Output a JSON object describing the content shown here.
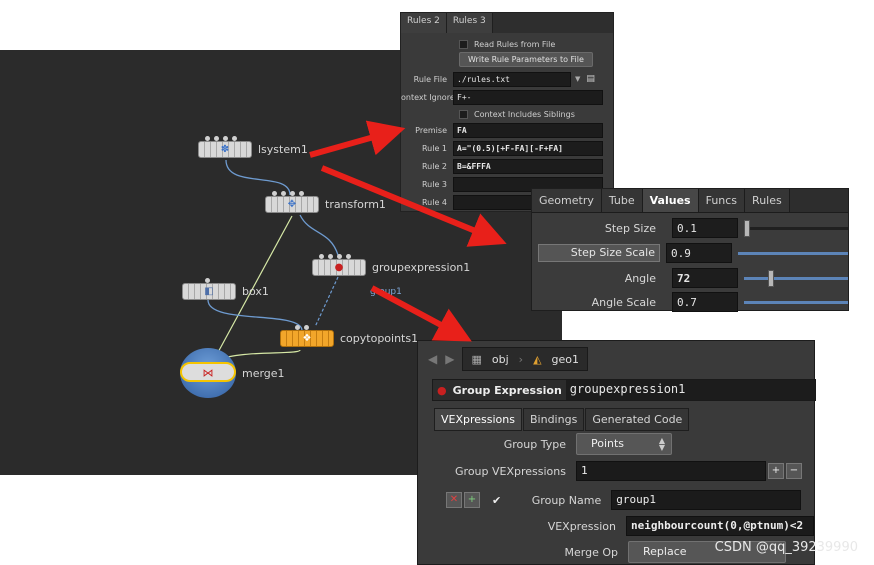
{
  "network": {
    "nodes": [
      {
        "name": "lsystem1",
        "icon": "lsystem-icon"
      },
      {
        "name": "transform1",
        "icon": "transform-icon"
      },
      {
        "name": "groupexpression1",
        "icon": "group-expression-icon",
        "sublabel": "group1"
      },
      {
        "name": "box1",
        "icon": "box-icon"
      },
      {
        "name": "copytopoints1",
        "icon": "copy-icon"
      },
      {
        "name": "merge1",
        "icon": "merge-icon"
      }
    ]
  },
  "rules_panel": {
    "tabs": [
      "Rules 2",
      "Rules 3"
    ],
    "read_rules_from_file": "Read Rules from File",
    "write_rule_button": "Write Rule Parameters to File",
    "rule_file_label": "Rule File",
    "rule_file_value": "./rules.txt",
    "context_ignore_label": "ontext Ignore",
    "context_ignore_value": "F+-",
    "context_siblings": "Context Includes Siblings",
    "premise_label": "Premise",
    "premise_value": "FA",
    "rule1_label": "Rule 1",
    "rule1_value": "A=\"(0.5)[+F-FA][-F+FA]",
    "rule2_label": "Rule 2",
    "rule2_value": "B=&FFFA",
    "rule3_label": "Rule 3",
    "rule3_value": "",
    "rule4_label": "Rule 4",
    "rule4_value": ""
  },
  "values_panel": {
    "tabs": [
      "Geometry",
      "Tube",
      "Values",
      "Funcs",
      "Rules"
    ],
    "active_tab": "Values",
    "step_size_label": "Step Size",
    "step_size": "0.1",
    "step_size_scale_label": "Step Size Scale",
    "step_size_scale": "0.9",
    "angle_label": "Angle",
    "angle": "72",
    "angle_scale_label": "Angle Scale",
    "angle_scale": "0.7"
  },
  "ge_panel": {
    "path": [
      "obj",
      "geo1"
    ],
    "node_type": "Group Expression",
    "node_name": "groupexpression1",
    "tabs": [
      "VEXpressions",
      "Bindings",
      "Generated Code"
    ],
    "active_tab": "VEXpressions",
    "group_type_label": "Group Type",
    "group_type_value": "Points",
    "group_vex_label": "Group VEXpressions",
    "group_vex_value": "1",
    "plus": "+",
    "minus": "−",
    "group_name_label": "Group Name",
    "group_name_value": "group1",
    "vexpression_label": "VEXpression",
    "vexpression_value": "neighbourcount(0,@ptnum)<2",
    "merge_op_label": "Merge Op",
    "merge_op_value": "Replace"
  },
  "watermark": "CSDN @qq_39239990",
  "colors": {
    "arrow": "#e8201a",
    "wire": "#6e9bd0",
    "selected": "#f5c400"
  }
}
